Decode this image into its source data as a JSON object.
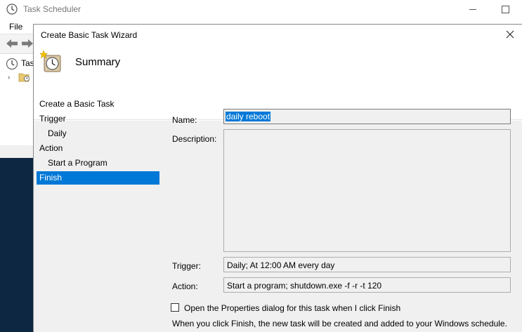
{
  "background_window": {
    "title": "Task Scheduler",
    "menu_file": "File",
    "tree_item_label": "Tas"
  },
  "wizard": {
    "title": "Create Basic Task Wizard",
    "header_title": "Summary",
    "nav": {
      "create_basic_task": "Create a Basic Task",
      "trigger": "Trigger",
      "daily": "Daily",
      "action": "Action",
      "start_program": "Start a Program",
      "finish": "Finish"
    },
    "fields": {
      "name_label": "Name:",
      "name_value": "daily reboot",
      "description_label": "Description:",
      "description_value": "",
      "trigger_label": "Trigger:",
      "trigger_value": "Daily; At 12:00 AM every day",
      "action_label": "Action:",
      "action_value": "Start a program; shutdown.exe -f -r -t 120"
    },
    "open_properties_checkbox": {
      "label": "Open the Properties dialog for this task when I click Finish",
      "checked": false
    },
    "info_text": "When you click Finish, the new task will be created and added to your Windows schedule."
  },
  "colors": {
    "selection": "#0078d7",
    "dialog_bg": "#f0f0f0",
    "taskbar": "#0d2742"
  }
}
